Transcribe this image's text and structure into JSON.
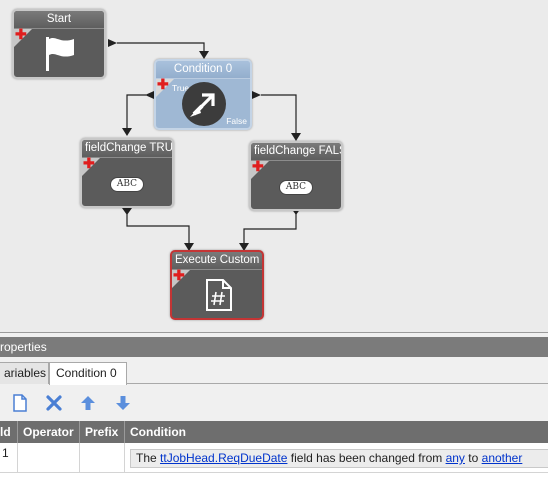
{
  "canvas": {
    "nodes": {
      "start": {
        "title": "Start"
      },
      "condition": {
        "title": "Condition 0",
        "true_label": "True",
        "false_label": "False"
      },
      "field_true": {
        "title": "fieldChange TRUE",
        "badge": "ABC"
      },
      "field_false": {
        "title": "fieldChange FALSE",
        "badge": "ABC"
      },
      "execute": {
        "title": "Execute Custom Co"
      }
    },
    "colors": {
      "node_body": "#5b5b5b",
      "condition_body": "#9fb8d4",
      "execute_border": "#c43535",
      "add_marker": "#e01e1e"
    }
  },
  "properties": {
    "header": "roperties",
    "tabs": [
      {
        "label": "Variables",
        "shown": "ariables"
      },
      {
        "label": "Condition 0"
      }
    ],
    "toolbar": [
      "new-document-icon",
      "delete-x-icon",
      "move-up-icon",
      "move-down-icon"
    ],
    "grid": {
      "columns": [
        "Id",
        "Operator",
        "Prefix",
        "Condition"
      ],
      "columns_shown": [
        "ld",
        "Operator",
        "Prefix",
        "Condition"
      ],
      "rows": [
        {
          "id": "1",
          "operator": "",
          "prefix": "",
          "condition": {
            "prefix_text": "The",
            "field_link": "ttJobHead.ReqDueDate",
            "middle_text": "field has been changed from",
            "from_link": "any",
            "to_text": "to",
            "to_link": "another"
          }
        }
      ]
    }
  }
}
